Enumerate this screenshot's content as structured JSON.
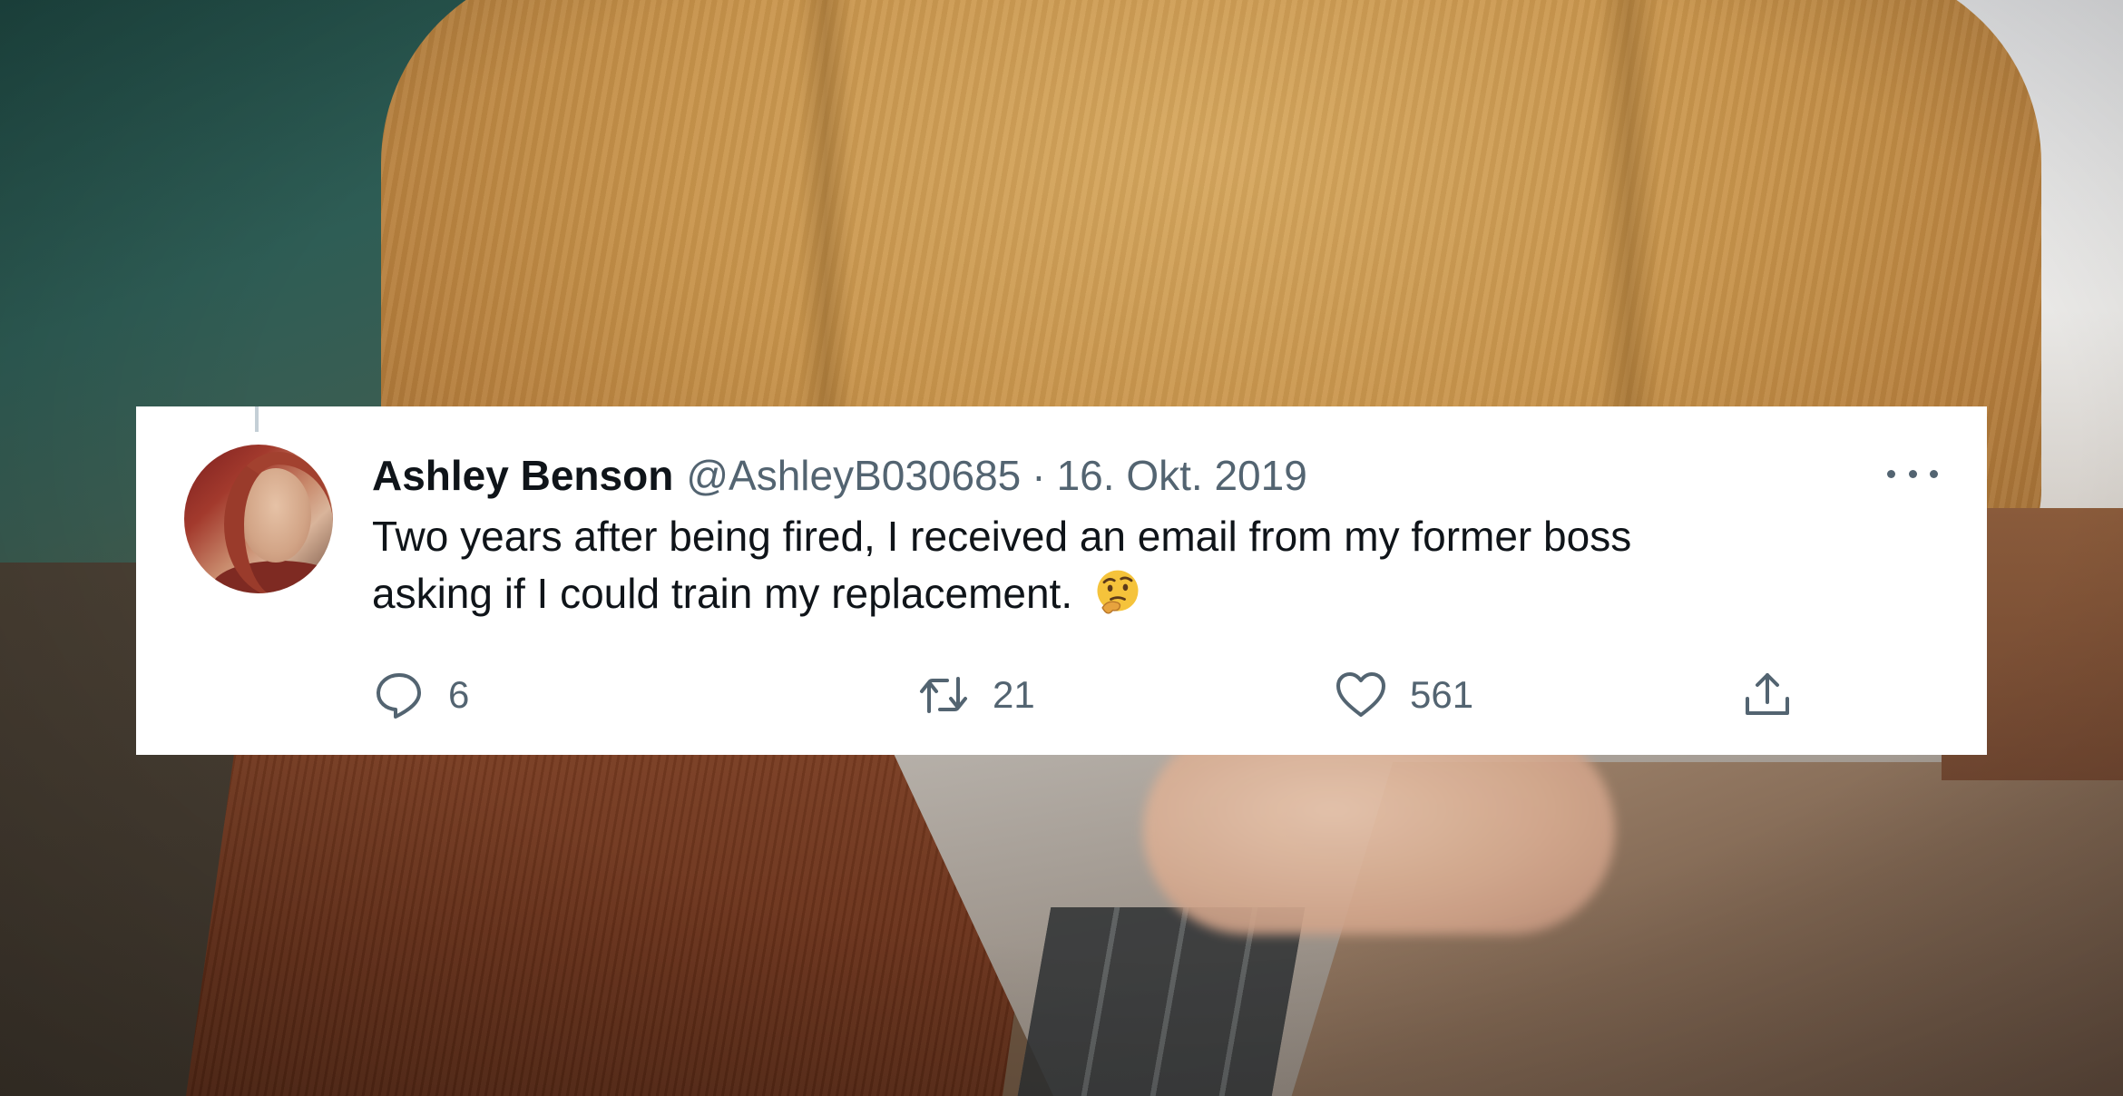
{
  "tweet": {
    "display_name": "Ashley Benson",
    "handle": "@AshleyB030685",
    "separator": "·",
    "date": "16. Okt. 2019",
    "text_line1": "Two years after being fired, I received an email from my former boss",
    "text_line2": "asking if I could train my replacement.",
    "emoji": "thinking-face",
    "more_menu": "more-options-icon",
    "actions": {
      "reply": {
        "icon": "reply-icon",
        "count": "6"
      },
      "retweet": {
        "icon": "retweet-icon",
        "count": "21"
      },
      "like": {
        "icon": "heart-icon",
        "count": "561"
      },
      "share": {
        "icon": "share-icon"
      }
    }
  },
  "colors": {
    "card_background": "#ffffff",
    "primary_text": "#0f1419",
    "secondary_text": "#536471",
    "sweater": "#c9954c",
    "wall_green": "#2e5d55"
  }
}
